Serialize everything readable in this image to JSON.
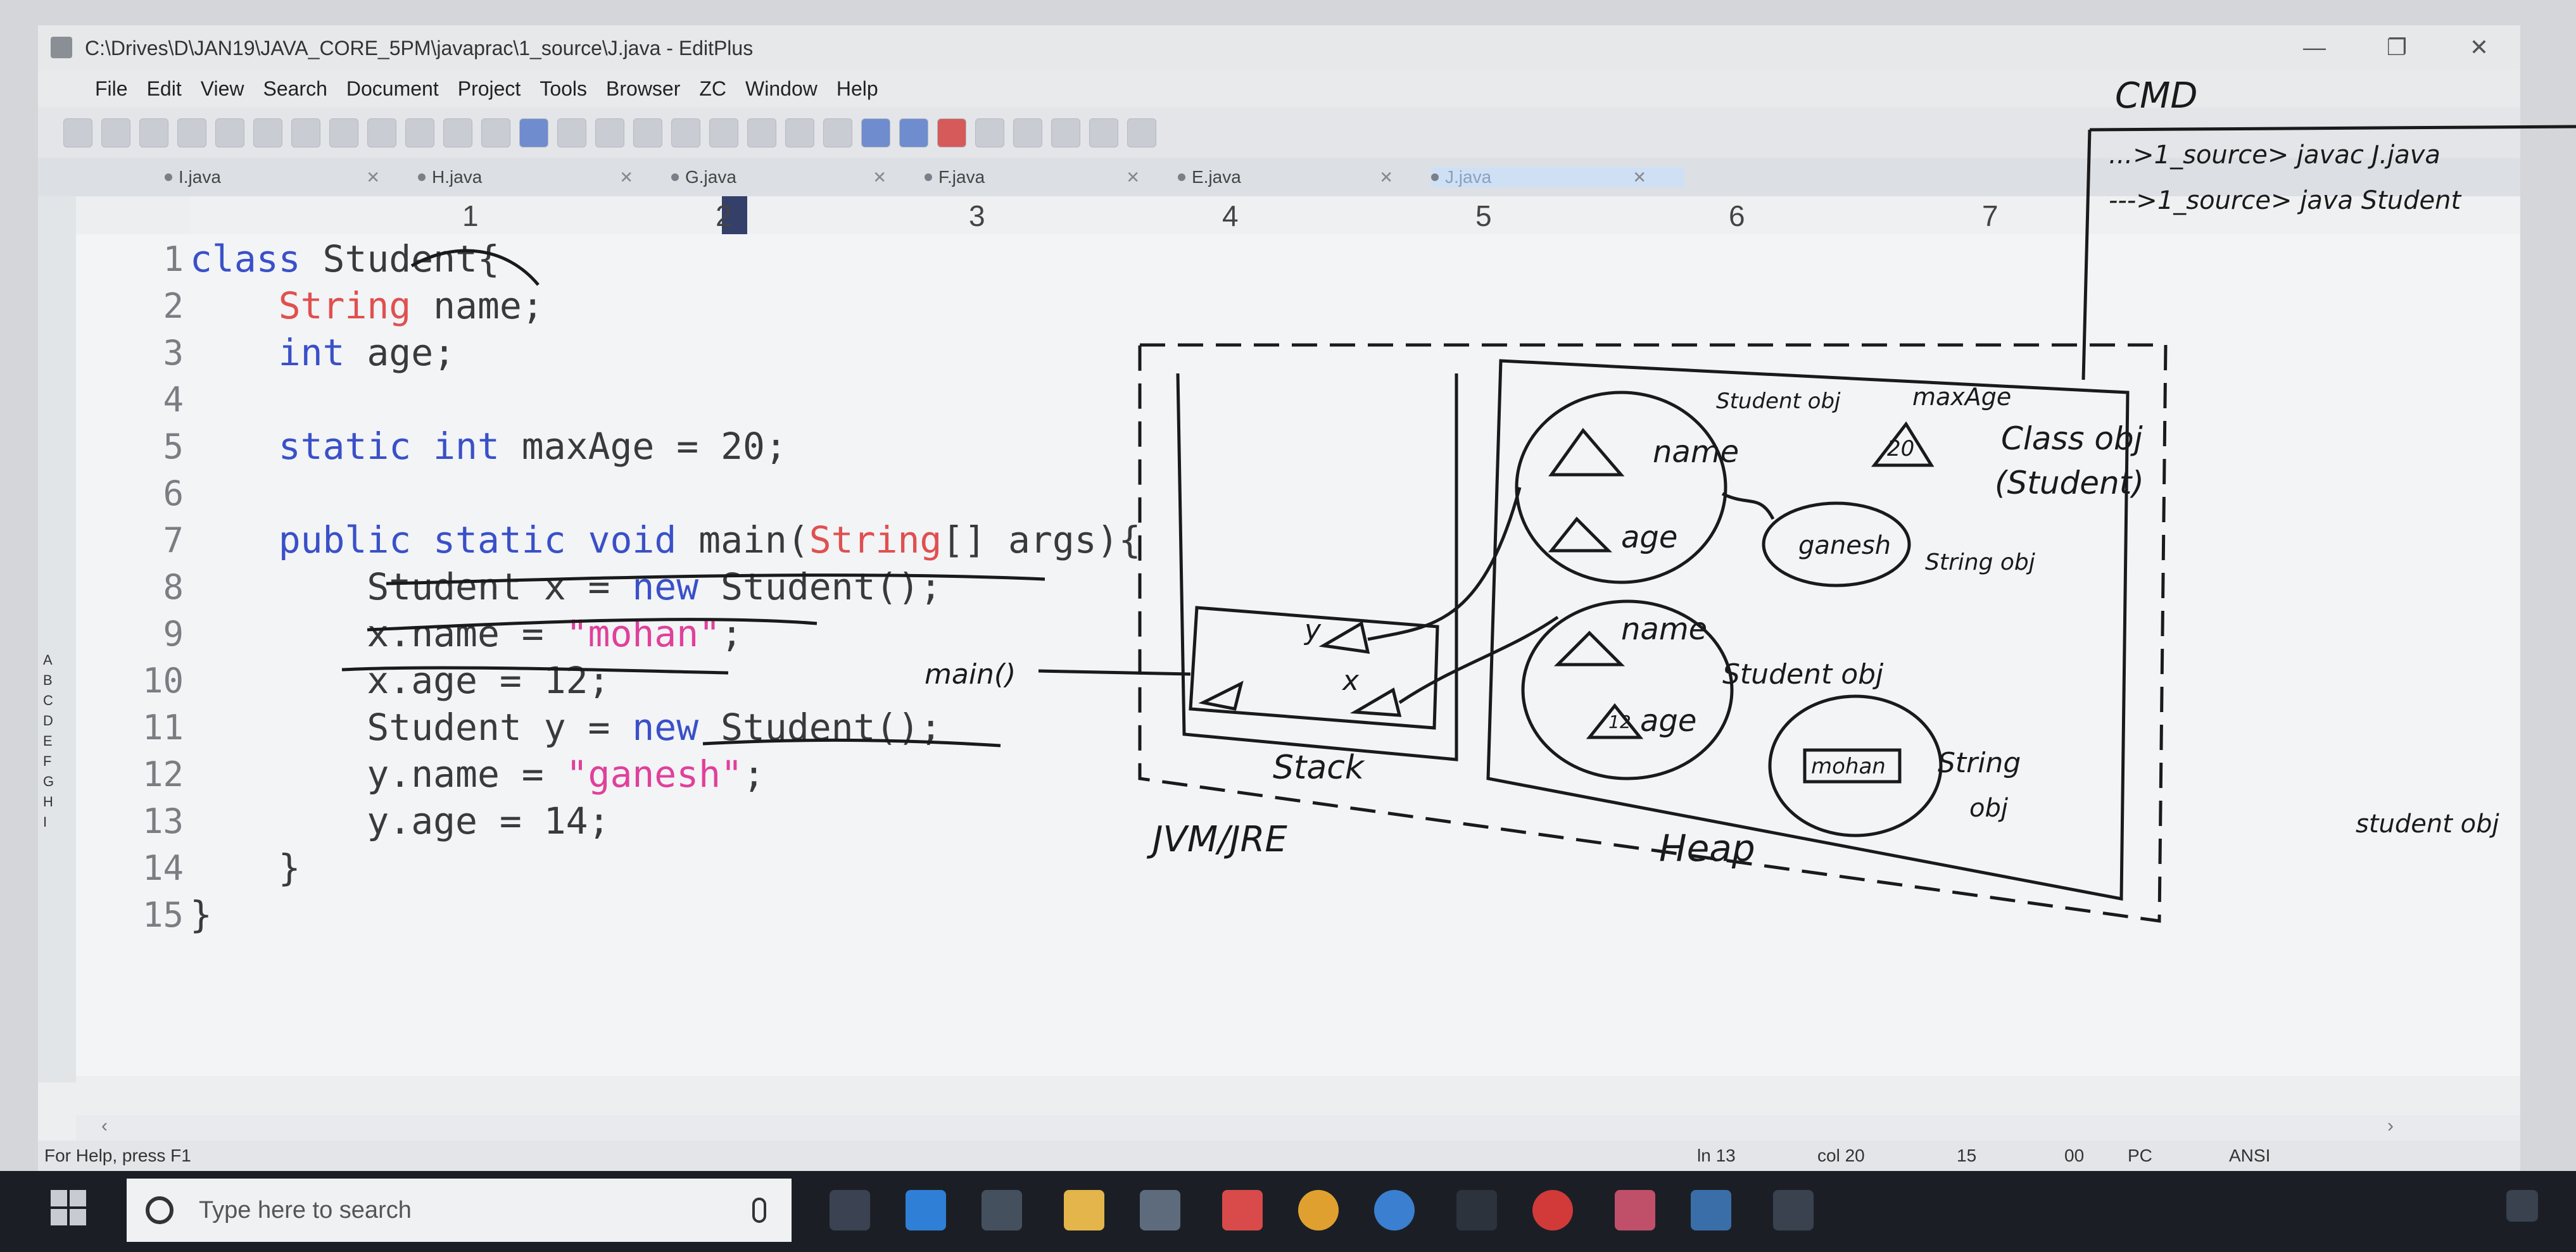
{
  "window": {
    "title": "C:\\Drives\\D\\JAN19\\JAVA_CORE_5PM\\javaprac\\1_source\\J.java - EditPlus",
    "controls": [
      "—",
      "❐",
      "✕"
    ]
  },
  "menu": [
    "File",
    "Edit",
    "View",
    "Search",
    "Document",
    "Project",
    "Tools",
    "Browser",
    "ZC",
    "Window",
    "Help"
  ],
  "tabs": [
    {
      "label": "I.java",
      "close": "✕"
    },
    {
      "label": "H.java",
      "close": "✕"
    },
    {
      "label": "G.java",
      "close": "✕"
    },
    {
      "label": "F.java",
      "close": "✕"
    },
    {
      "label": "E.java",
      "close": "✕"
    },
    {
      "label": "J.java",
      "close": "✕"
    }
  ],
  "ruler": [
    "1",
    "2",
    "3",
    "4",
    "5",
    "6",
    "7"
  ],
  "gutter_clips": [
    "A",
    "B",
    "C",
    "D",
    "E",
    "F",
    "G",
    "H",
    "I"
  ],
  "code_lines": [
    {
      "n": "1",
      "text": "class Student{"
    },
    {
      "n": "2",
      "text": "    String name;"
    },
    {
      "n": "3",
      "text": "    int age;"
    },
    {
      "n": "4",
      "text": ""
    },
    {
      "n": "5",
      "text": "    static int maxAge = 20;"
    },
    {
      "n": "6",
      "text": ""
    },
    {
      "n": "7",
      "text": "    public static void main(String[] args){"
    },
    {
      "n": "8",
      "text": "        Student x = new Student();"
    },
    {
      "n": "9",
      "text": "        x.name = \"mohan\";"
    },
    {
      "n": "10",
      "text": "        x.age = 12;"
    },
    {
      "n": "11",
      "text": "        Student y = new Student();"
    },
    {
      "n": "12",
      "text": "        y.name = \"ganesh\";"
    },
    {
      "n": "13",
      "text": "        y.age = 14;"
    },
    {
      "n": "14",
      "text": "    }"
    },
    {
      "n": "15",
      "text": "}"
    }
  ],
  "status": {
    "help": "For Help, press F1",
    "ln": "ln 13",
    "col": "col 20",
    "num": "15",
    "ovr": "00",
    "mode": "PC",
    "enc": "ANSI"
  },
  "taskbar": {
    "search_placeholder": "Type here to search"
  },
  "annotations": {
    "cmd_title": "CMD",
    "cmd_line1": "...>1_source> javac J.java",
    "cmd_line2": "--->1_source> java Student",
    "main_label": "main()",
    "stack_label": "Stack",
    "jvm_label": "JVM/JRE",
    "heap_label": "Heap",
    "student_obj_top": "Student obj",
    "name_label": "name",
    "age_label": "age",
    "maxage_label": "maxAge",
    "maxage_value": "20",
    "class_obj": "Class obj",
    "class_obj_sub": "(Student)",
    "ganesh_label": "ganesh",
    "string_obj1": "String obj",
    "student_obj2": "Student obj",
    "name2": "name",
    "age2": "age",
    "age2_val": "12",
    "mohan_label": "mohan",
    "string_obj2a": "String",
    "string_obj2b": "obj",
    "right_student_obj": "student obj",
    "y_label": "y",
    "x_label": "x"
  }
}
